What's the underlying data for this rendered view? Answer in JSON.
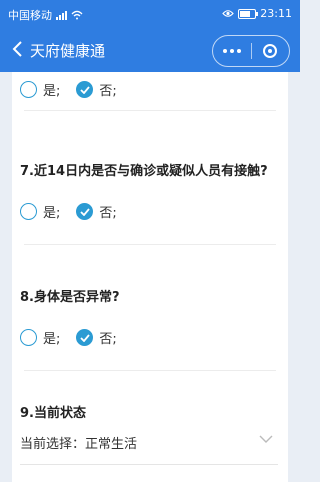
{
  "status_bar": {
    "carrier": "中国移动",
    "time": "23:11"
  },
  "nav": {
    "title": "天府健康通"
  },
  "questions": [
    {
      "title": "",
      "options": [
        "是;",
        "否;"
      ],
      "selected": 1
    },
    {
      "title": "7.近14日内是否与确诊或疑似人员有接触?",
      "options": [
        "是;",
        "否;"
      ],
      "selected": 1
    },
    {
      "title": "8.身体是否异常?",
      "options": [
        "是;",
        "否;"
      ],
      "selected": 1
    }
  ],
  "status_question": {
    "title": "9.当前状态",
    "current": "当前选择：正常生活"
  },
  "colors": {
    "brand": "#2f7de1",
    "radio": "#2b9bd3"
  },
  "icons": [
    "back-icon",
    "more-dots-icon",
    "target-icon",
    "check-icon",
    "chevron-down-icon",
    "signal-icon",
    "wifi-icon",
    "battery-icon",
    "eye-icon"
  ]
}
